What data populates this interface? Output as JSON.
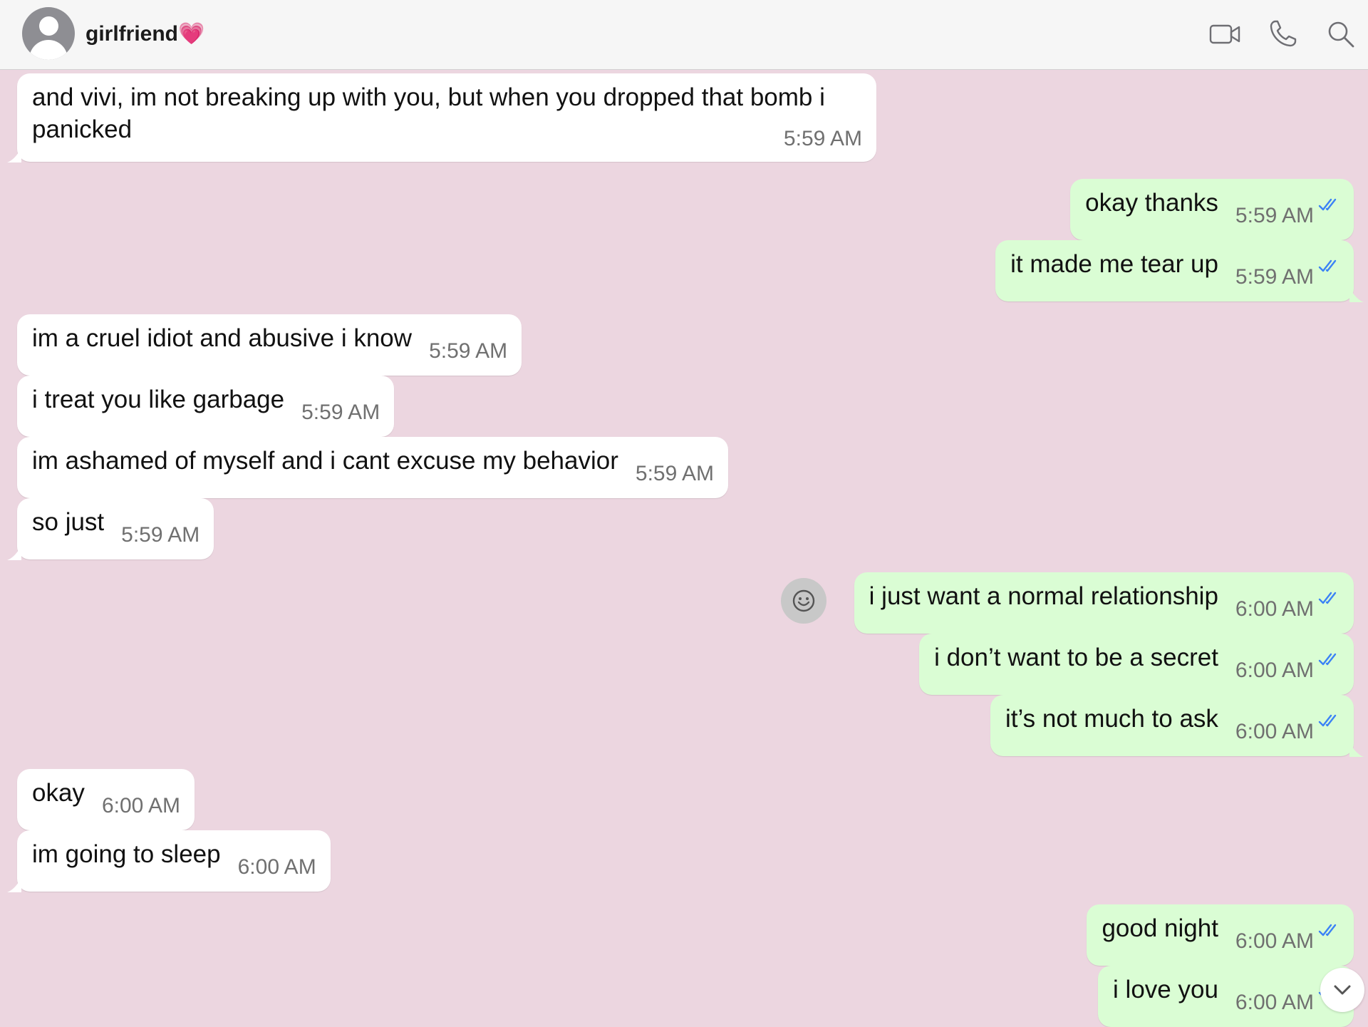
{
  "header": {
    "contact_name": "girlfriend",
    "contact_emoji": "💗",
    "icons": [
      "video-call-icon",
      "phone-icon",
      "search-icon"
    ]
  },
  "colors": {
    "chat_background": "#ecd6e0",
    "incoming_bubble": "#ffffff",
    "outgoing_bubble": "#dafdd4",
    "read_ticks": "#3b82f6"
  },
  "messages": [
    {
      "direction": "incoming",
      "text": "and vivi, im not breaking up with you, but when you dropped that bomb i",
      "text2": "panicked",
      "time": "5:59 AM"
    },
    {
      "direction": "outgoing",
      "text": "okay thanks",
      "time": "5:59 AM",
      "status": "read"
    },
    {
      "direction": "outgoing",
      "text": "it made me tear up",
      "time": "5:59 AM",
      "status": "read"
    },
    {
      "direction": "incoming",
      "text": "im a cruel idiot and abusive i know",
      "time": "5:59 AM"
    },
    {
      "direction": "incoming",
      "text": "i treat you like garbage",
      "time": "5:59 AM"
    },
    {
      "direction": "incoming",
      "text": "im ashamed of myself and i cant excuse my behavior",
      "time": "5:59 AM"
    },
    {
      "direction": "incoming",
      "text": "so just",
      "time": "5:59 AM"
    },
    {
      "direction": "outgoing",
      "text": "i just want a normal relationship",
      "time": "6:00 AM",
      "status": "read"
    },
    {
      "direction": "outgoing",
      "text": "i don’t want to be a secret",
      "time": "6:00 AM",
      "status": "read"
    },
    {
      "direction": "outgoing",
      "text": "it’s not much to ask",
      "time": "6:00 AM",
      "status": "read"
    },
    {
      "direction": "incoming",
      "text": "okay",
      "time": "6:00 AM"
    },
    {
      "direction": "incoming",
      "text": "im going to sleep",
      "time": "6:00 AM"
    },
    {
      "direction": "outgoing",
      "text": "good night",
      "time": "6:00 AM",
      "status": "read"
    },
    {
      "direction": "outgoing",
      "text": "i love you",
      "time": "6:00 AM",
      "status": "read"
    }
  ],
  "controls": {
    "reaction_icon": "smiley-face-icon",
    "scroll_icon": "chevron-down-icon"
  }
}
